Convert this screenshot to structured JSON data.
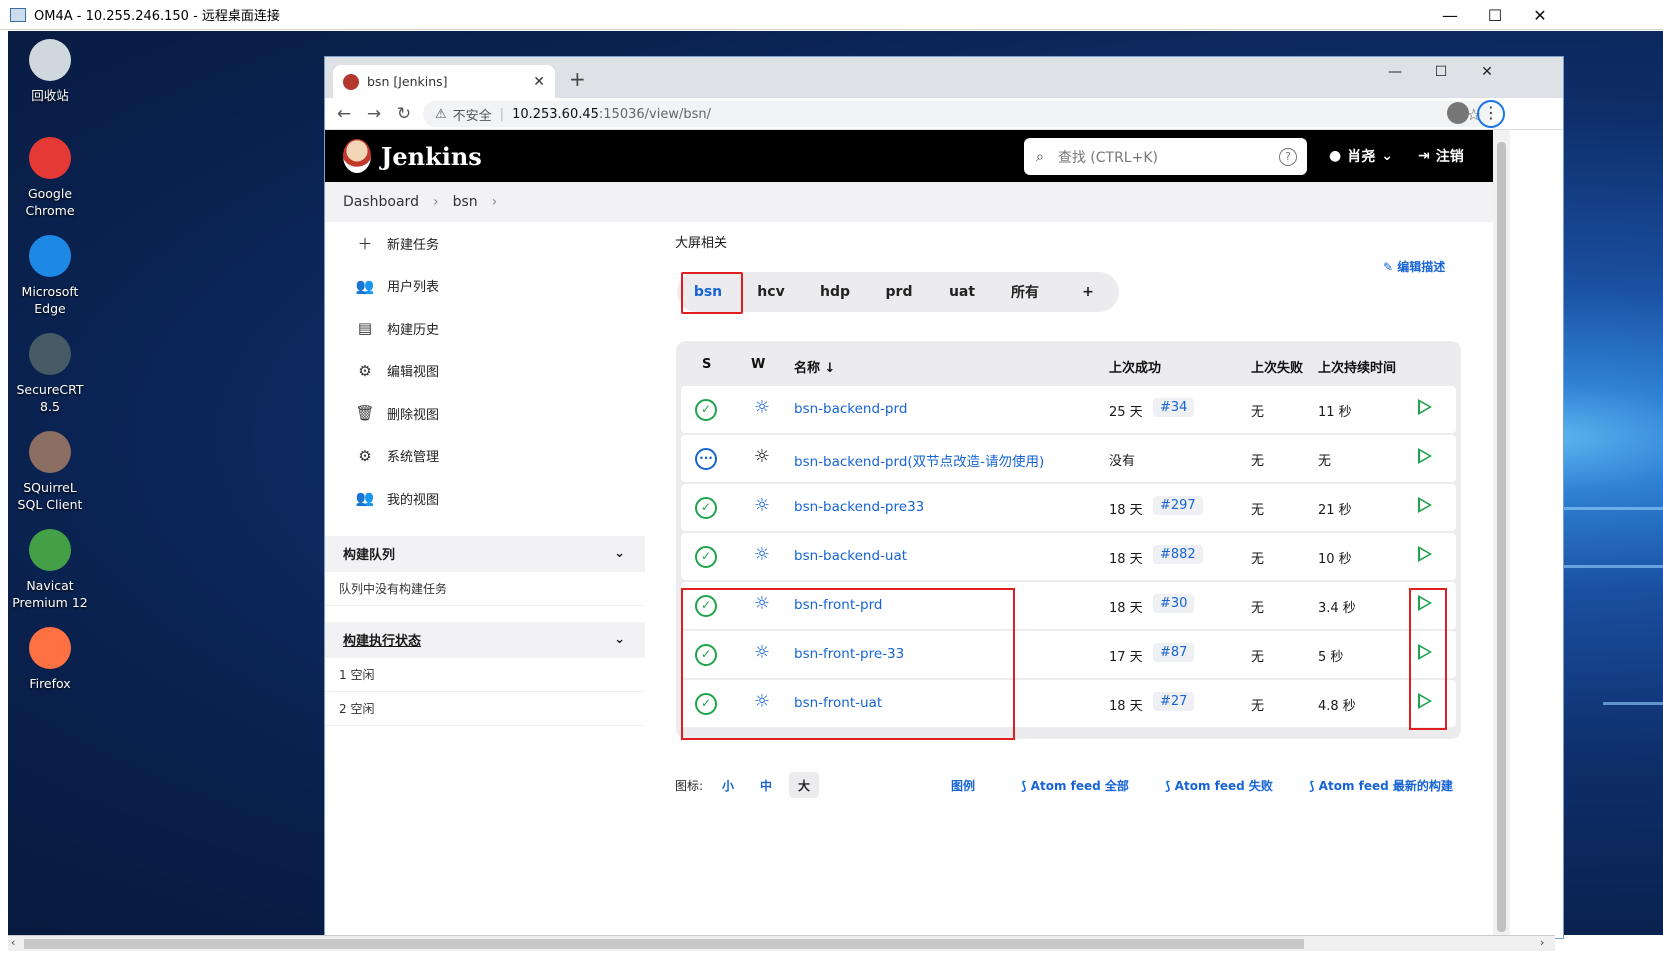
{
  "rdp": {
    "title": "OM4A - 10.255.246.150 - 远程桌面连接",
    "min": "—",
    "max": "☐",
    "close": "✕"
  },
  "desktop": {
    "icons": [
      {
        "label": "回收站",
        "icon": "recycle-bin-icon",
        "color": "#cfd8dc"
      },
      {
        "label": "Google Chrome",
        "icon": "chrome-icon",
        "color": "#e53935"
      },
      {
        "label": "Microsoft Edge",
        "icon": "edge-icon",
        "color": "#1e88e5"
      },
      {
        "label": "SecureCRT 8.5",
        "icon": "securecrt-icon",
        "color": "#455a64"
      },
      {
        "label": "SQuirreL SQL Client",
        "icon": "squirrel-icon",
        "color": "#8d6e63"
      },
      {
        "label": "Navicat Premium 12",
        "icon": "navicat-icon",
        "color": "#43a047"
      },
      {
        "label": "Firefox",
        "icon": "firefox-icon",
        "color": "#ff7043"
      }
    ]
  },
  "browser": {
    "tab_title": "bsn [Jenkins]",
    "tab_close": "✕",
    "new_tab": "+",
    "min": "—",
    "max": "☐",
    "close": "✕",
    "back": "←",
    "forward": "→",
    "reload": "↻",
    "warn_icon": "⚠",
    "insecure": "不安全",
    "host": "10.253.60.45",
    "path": ":15036/view/bsn/",
    "star": "☆",
    "menu": "⋮"
  },
  "jenkins": {
    "name": "Jenkins",
    "search_placeholder": "查找 (CTRL+K)",
    "search_icon": "⌕",
    "help": "?",
    "user": "肖尧",
    "user_caret": "⌄",
    "logout": "注销",
    "breadcrumb": [
      "Dashboard",
      "bsn"
    ],
    "chev": "›",
    "sidebar": [
      {
        "icon": "＋",
        "label": "新建任务"
      },
      {
        "icon": "👥",
        "label": "用户列表"
      },
      {
        "icon": "▤",
        "label": "构建历史"
      },
      {
        "icon": "⚙",
        "label": "编辑视图"
      },
      {
        "icon": "🗑",
        "label": "删除视图"
      },
      {
        "icon": "⚙",
        "label": "系统管理"
      },
      {
        "icon": "👥",
        "label": "我的视图"
      }
    ],
    "queue": {
      "title": "构建队列",
      "empty": "队列中没有构建任务",
      "toggle": "⌄"
    },
    "executors": {
      "title": "构建执行状态",
      "toggle": "⌄",
      "items": [
        "1  空闲",
        "2  空闲"
      ]
    },
    "view_description": "大屏相关",
    "edit_description": "✎ 编辑描述",
    "view_tabs": [
      "bsn",
      "hcv",
      "hdp",
      "prd",
      "uat",
      "所有",
      "+"
    ],
    "columns": {
      "s": "S",
      "w": "W",
      "name": "名称 ↓",
      "last_success": "上次成功",
      "last_failure": "上次失败",
      "last_duration": "上次持续时间"
    },
    "jobs": [
      {
        "name": "bsn-backend-prd",
        "status": "success",
        "weather": "sunny",
        "last_success": "25 天",
        "build": "#34",
        "last_failure": "无",
        "duration": "11 秒"
      },
      {
        "name": "bsn-backend-prd(双节点改造-请勿使用)",
        "status": "notbuilt",
        "weather": "unknown",
        "last_success": "没有",
        "build": "",
        "last_failure": "无",
        "duration": "无"
      },
      {
        "name": "bsn-backend-pre33",
        "status": "success",
        "weather": "sunny",
        "last_success": "18 天",
        "build": "#297",
        "last_failure": "无",
        "duration": "21 秒"
      },
      {
        "name": "bsn-backend-uat",
        "status": "success",
        "weather": "sunny",
        "last_success": "18 天",
        "build": "#882",
        "last_failure": "无",
        "duration": "10 秒"
      },
      {
        "name": "bsn-front-prd",
        "status": "success",
        "weather": "sunny",
        "last_success": "18 天",
        "build": "#30",
        "last_failure": "无",
        "duration": "3.4 秒"
      },
      {
        "name": "bsn-front-pre-33",
        "status": "success",
        "weather": "sunny",
        "last_success": "17 天",
        "build": "#87",
        "last_failure": "无",
        "duration": "5 秒"
      },
      {
        "name": "bsn-front-uat",
        "status": "success",
        "weather": "sunny",
        "last_success": "18 天",
        "build": "#27",
        "last_failure": "无",
        "duration": "4.8 秒"
      }
    ],
    "footer": {
      "icon_label": "图标:",
      "sizes": [
        "小",
        "中",
        "大"
      ],
      "legend": "图例",
      "feed_all": "Atom feed 全部",
      "feed_fail": "Atom feed 失败",
      "feed_latest": "Atom feed 最新的构建"
    },
    "status_glyphs": {
      "success": "✓",
      "notbuilt": "···",
      "sunny": "☼",
      "unknown": "☼"
    }
  },
  "scroll": {
    "left": "‹",
    "right": "›"
  }
}
